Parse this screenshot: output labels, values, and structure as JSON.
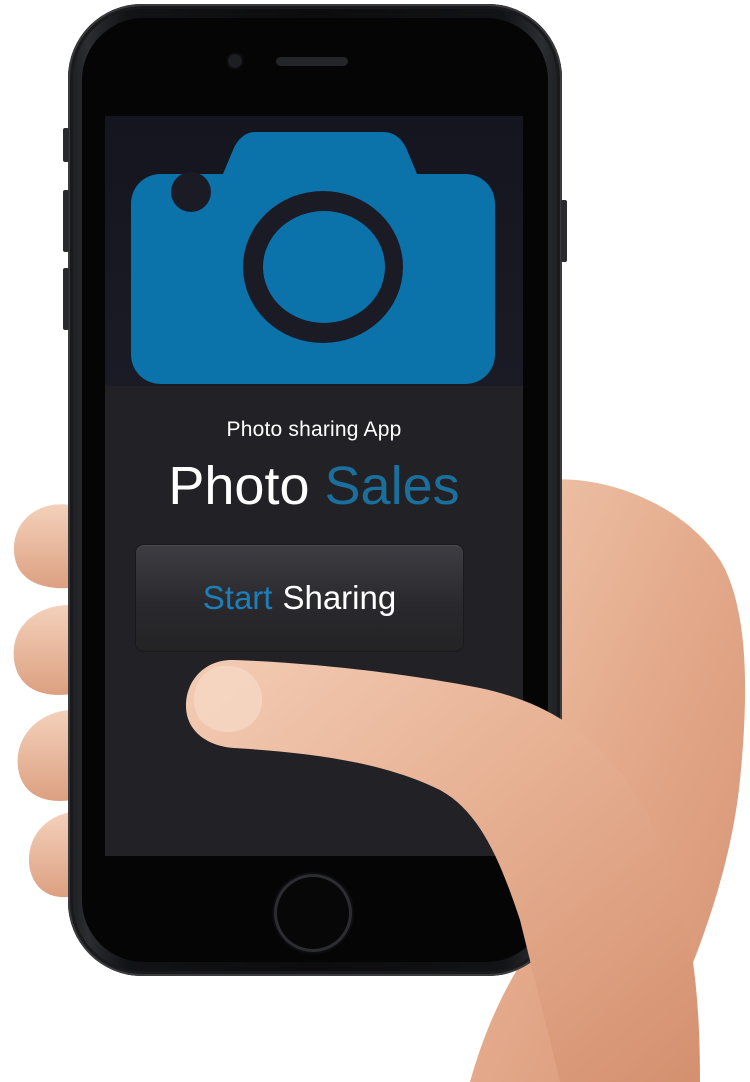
{
  "app": {
    "subtitle": "Photo sharing App",
    "title_primary": "Photo",
    "title_accent": "Sales",
    "start_accent": "Start",
    "start_rest": "Sharing"
  },
  "icons": {
    "hero_icon": "camera-icon"
  },
  "colors": {
    "accent": "#1d7fb8",
    "camera_blue": "#0c72aa",
    "screen_bg": "#222226",
    "button_bg": "#2e2e32"
  }
}
